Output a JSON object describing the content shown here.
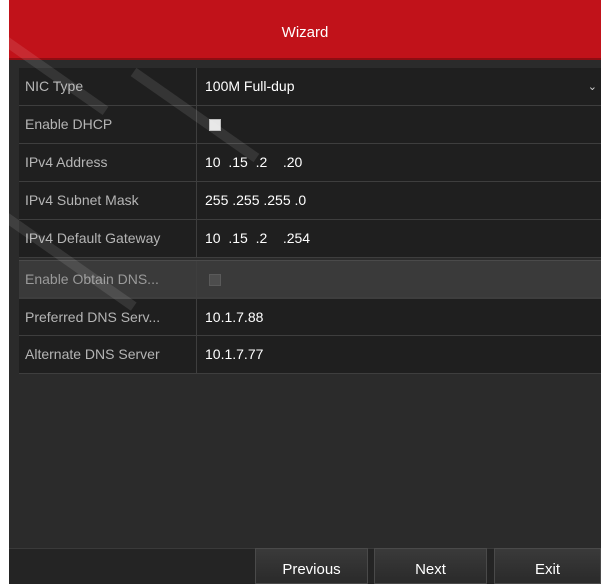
{
  "dialog": {
    "title": "Wizard"
  },
  "network": {
    "nic_type": {
      "label": "NIC Type",
      "value": "100M Full-dup"
    },
    "enable_dhcp": {
      "label": "Enable DHCP",
      "checked": false
    },
    "ipv4_address": {
      "label": "IPv4 Address",
      "value": "10  .15  .2    .20"
    },
    "ipv4_subnet_mask": {
      "label": "IPv4 Subnet Mask",
      "value": "255 .255 .255 .0"
    },
    "ipv4_default_gateway": {
      "label": "IPv4 Default Gateway",
      "value": "10  .15  .2    .254"
    },
    "enable_obtain_dns": {
      "label": "Enable Obtain DNS...",
      "checked": false,
      "disabled": true
    },
    "preferred_dns": {
      "label": "Preferred DNS Serv...",
      "value": "10.1.7.88"
    },
    "alternate_dns": {
      "label": "Alternate DNS Server",
      "value": "10.1.7.77"
    }
  },
  "buttons": {
    "previous": "Previous",
    "next": "Next",
    "exit": "Exit"
  },
  "colors": {
    "title_bar": "#c1121a",
    "background": "#2b2b2b",
    "row_background": "#1f1f1f"
  }
}
